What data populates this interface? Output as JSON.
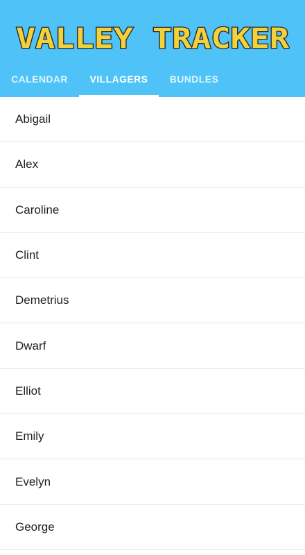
{
  "header": {
    "title": "VALLEY TRACKER",
    "background_color": "#4FC3F7",
    "title_color": "#F2D23C"
  },
  "tabs": [
    {
      "label": "CALENDAR",
      "active": false
    },
    {
      "label": "VILLAGERS",
      "active": true
    },
    {
      "label": "BUNDLES",
      "active": false
    }
  ],
  "villagers": [
    "Abigail",
    "Alex",
    "Caroline",
    "Clint",
    "Demetrius",
    "Dwarf",
    "Elliot",
    "Emily",
    "Evelyn",
    "George"
  ]
}
